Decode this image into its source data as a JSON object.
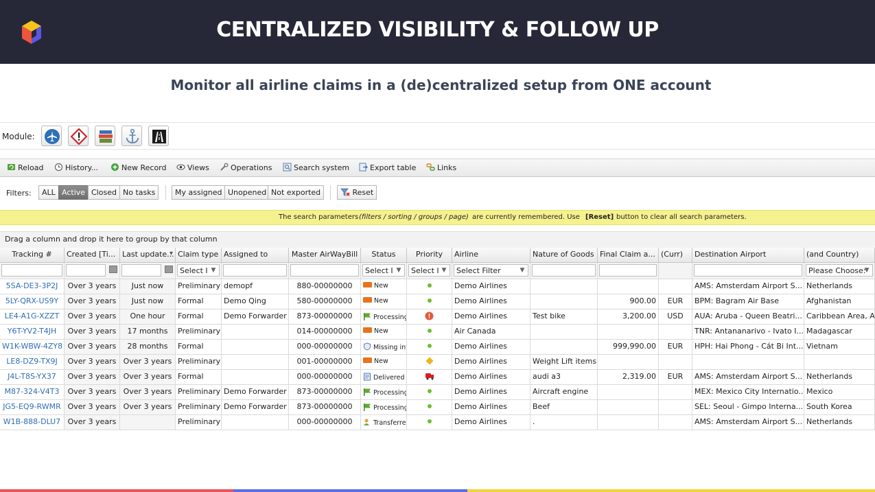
{
  "banner": {
    "title": "CENTRALIZED VISIBILITY & FOLLOW UP"
  },
  "subtitle": "Monitor all airline claims in a (de)centralized setup from ONE account",
  "module": {
    "label": "Module:",
    "icons": [
      "airplane-icon",
      "hazard-icon",
      "books-icon",
      "anchor-icon",
      "road-icon"
    ]
  },
  "toolbar": {
    "reload": "Reload",
    "history": "History...",
    "new_record": "New Record",
    "views": "Views",
    "operations": "Operations",
    "search_system": "Search system",
    "export_table": "Export table",
    "links": "Links"
  },
  "filters": {
    "label": "Filters:",
    "all": "ALL",
    "active": "Active",
    "closed": "Closed",
    "no_tasks": "No tasks",
    "my_assigned": "My assigned",
    "unopened": "Unopened",
    "not_exported": "Not exported",
    "reset": "Reset"
  },
  "notice": {
    "pre": "The search parameters",
    "italic": "(filters / sorting / groups / page)",
    "mid": "are currently remembered.  Use",
    "bold": "[Reset]",
    "post": "button to clear all search parameters."
  },
  "group_hint": "Drag a column and drop it here to group by that column",
  "grid": {
    "headers": [
      "Tracking #",
      "Created [Ti...",
      "Last update...",
      "Claim type",
      "Assigned to",
      "Master AirWayBill",
      "Status",
      "Priority",
      "Airline",
      "Nature of Goods",
      "Final Claim a...",
      "(Curr)",
      "Destination Airport",
      "(and Country)"
    ],
    "filters": {
      "claim_type": "Select I",
      "status": "Select I",
      "priority": "Select I",
      "airline": "Select Filter",
      "country": "Please Choose:"
    },
    "rows": [
      {
        "tracking": "5SA-DE3-3P2J",
        "created": "Over 3 years",
        "updated": "Just now",
        "type": "Preliminary",
        "assigned": "demopf",
        "awb": "880-00000000",
        "status": "New",
        "status_icon": "new-badge-icon",
        "priority": "low",
        "priority_icon": "green-dot-icon",
        "airline": "Demo Airlines",
        "goods": "",
        "amount": "",
        "curr": "",
        "dest": "AMS: Amsterdam Airport S...",
        "country": "Netherlands"
      },
      {
        "tracking": "5LY-QRX-US9Y",
        "created": "Over 3 years",
        "updated": "Just now",
        "type": "Formal",
        "assigned": "Demo Qing",
        "awb": "580-00000000",
        "status": "New",
        "status_icon": "new-badge-icon",
        "priority": "low",
        "priority_icon": "green-dot-icon",
        "airline": "Demo Airlines",
        "goods": "",
        "amount": "900.00",
        "curr": "EUR",
        "dest": "BPM: Bagram Air Base",
        "country": "Afghanistan"
      },
      {
        "tracking": "LE4-A1G-XZZT",
        "created": "Over 3 years",
        "updated": "One hour",
        "type": "Formal",
        "assigned": "Demo Forwarder",
        "awb": "873-00000000",
        "status": "Processing",
        "status_icon": "green-flag-icon",
        "priority": "high",
        "priority_icon": "red-alert-icon",
        "airline": "Demo Airlines",
        "goods": "Test bike",
        "amount": "3,200.00",
        "curr": "USD",
        "dest": "AUA: Aruba - Queen Beatri...",
        "country": "Caribbean Area, Ar"
      },
      {
        "tracking": "Y6T-YV2-T4JH",
        "created": "Over 3 years",
        "updated": "17 months",
        "type": "Preliminary",
        "assigned": "",
        "awb": "014-00000000",
        "status": "New",
        "status_icon": "new-badge-icon",
        "priority": "low",
        "priority_icon": "green-dot-icon",
        "airline": "Air Canada",
        "goods": "",
        "amount": "",
        "curr": "",
        "dest": "TNR: Antananarivo - Ivato I...",
        "country": "Madagascar"
      },
      {
        "tracking": "W1K-WBW-4ZY8",
        "created": "Over 3 years",
        "updated": "28 months",
        "type": "Formal",
        "assigned": "",
        "awb": "000-00000000",
        "status": "Missing inf",
        "status_icon": "shield-icon",
        "priority": "low",
        "priority_icon": "green-dot-icon",
        "airline": "Demo Airlines",
        "goods": "",
        "amount": "999,990.00",
        "curr": "EUR",
        "dest": "HPH: Hai Phong - Cát Bi Int...",
        "country": "Vietnam"
      },
      {
        "tracking": "LE8-DZ9-TX9J",
        "created": "Over 3 years",
        "updated": "Over 3 years",
        "type": "Preliminary",
        "assigned": "",
        "awb": "001-00000000",
        "status": "New",
        "status_icon": "new-badge-icon",
        "priority": "medium",
        "priority_icon": "orange-diamond-icon",
        "airline": "Demo Airlines",
        "goods": "Weight Lift items",
        "amount": "",
        "curr": "",
        "dest": "",
        "country": ""
      },
      {
        "tracking": "J4L-T8S-YX37",
        "created": "Over 3 years",
        "updated": "Over 3 years",
        "type": "Formal",
        "assigned": "",
        "awb": "000-00000000",
        "status": "Delivered",
        "status_icon": "document-icon",
        "priority": "urgent",
        "priority_icon": "red-truck-icon",
        "airline": "Demo Airlines",
        "goods": "audi a3",
        "amount": "2,319.00",
        "curr": "EUR",
        "dest": "AMS: Amsterdam Airport S...",
        "country": "Netherlands"
      },
      {
        "tracking": "M87-324-V4T3",
        "created": "Over 3 years",
        "updated": "Over 3 years",
        "type": "Preliminary",
        "assigned": "Demo Forwarder",
        "awb": "873-00000000",
        "status": "Processing",
        "status_icon": "green-flag-icon",
        "priority": "low",
        "priority_icon": "green-dot-icon",
        "airline": "Demo Airlines",
        "goods": "Aircraft engine",
        "amount": "",
        "curr": "",
        "dest": "MEX: Mexico City Internatio...",
        "country": "Mexico"
      },
      {
        "tracking": "JG5-EQ9-RWMR",
        "created": "Over 3 years",
        "updated": "Over 3 years",
        "type": "Preliminary",
        "assigned": "Demo Forwarder",
        "awb": "873-00000000",
        "status": "Processing",
        "status_icon": "green-flag-icon",
        "priority": "low",
        "priority_icon": "green-dot-icon",
        "airline": "Demo Airlines",
        "goods": "Beef",
        "amount": "",
        "curr": "",
        "dest": "SEL: Seoul - Gimpo Interna...",
        "country": "South Korea"
      },
      {
        "tracking": "W1B-888-DLU7",
        "created": "Over 3 years",
        "updated": "",
        "type": "Preliminary",
        "assigned": "",
        "awb": "000-00000000",
        "status": "Transferre",
        "status_icon": "transfer-icon",
        "priority": "low",
        "priority_icon": "green-dot-icon",
        "airline": "Demo Airlines",
        "goods": ".",
        "amount": "",
        "curr": "",
        "dest": "AMS: Amsterdam Airport S...",
        "country": "Netherlands"
      }
    ]
  },
  "colors": {
    "banner_bg": "#262838",
    "link": "#2f6db3",
    "notice_bg": "#f6f18f",
    "stripe_red": "#e8545a",
    "stripe_blue": "#5b6ee1",
    "stripe_yellow": "#f2d33e"
  }
}
